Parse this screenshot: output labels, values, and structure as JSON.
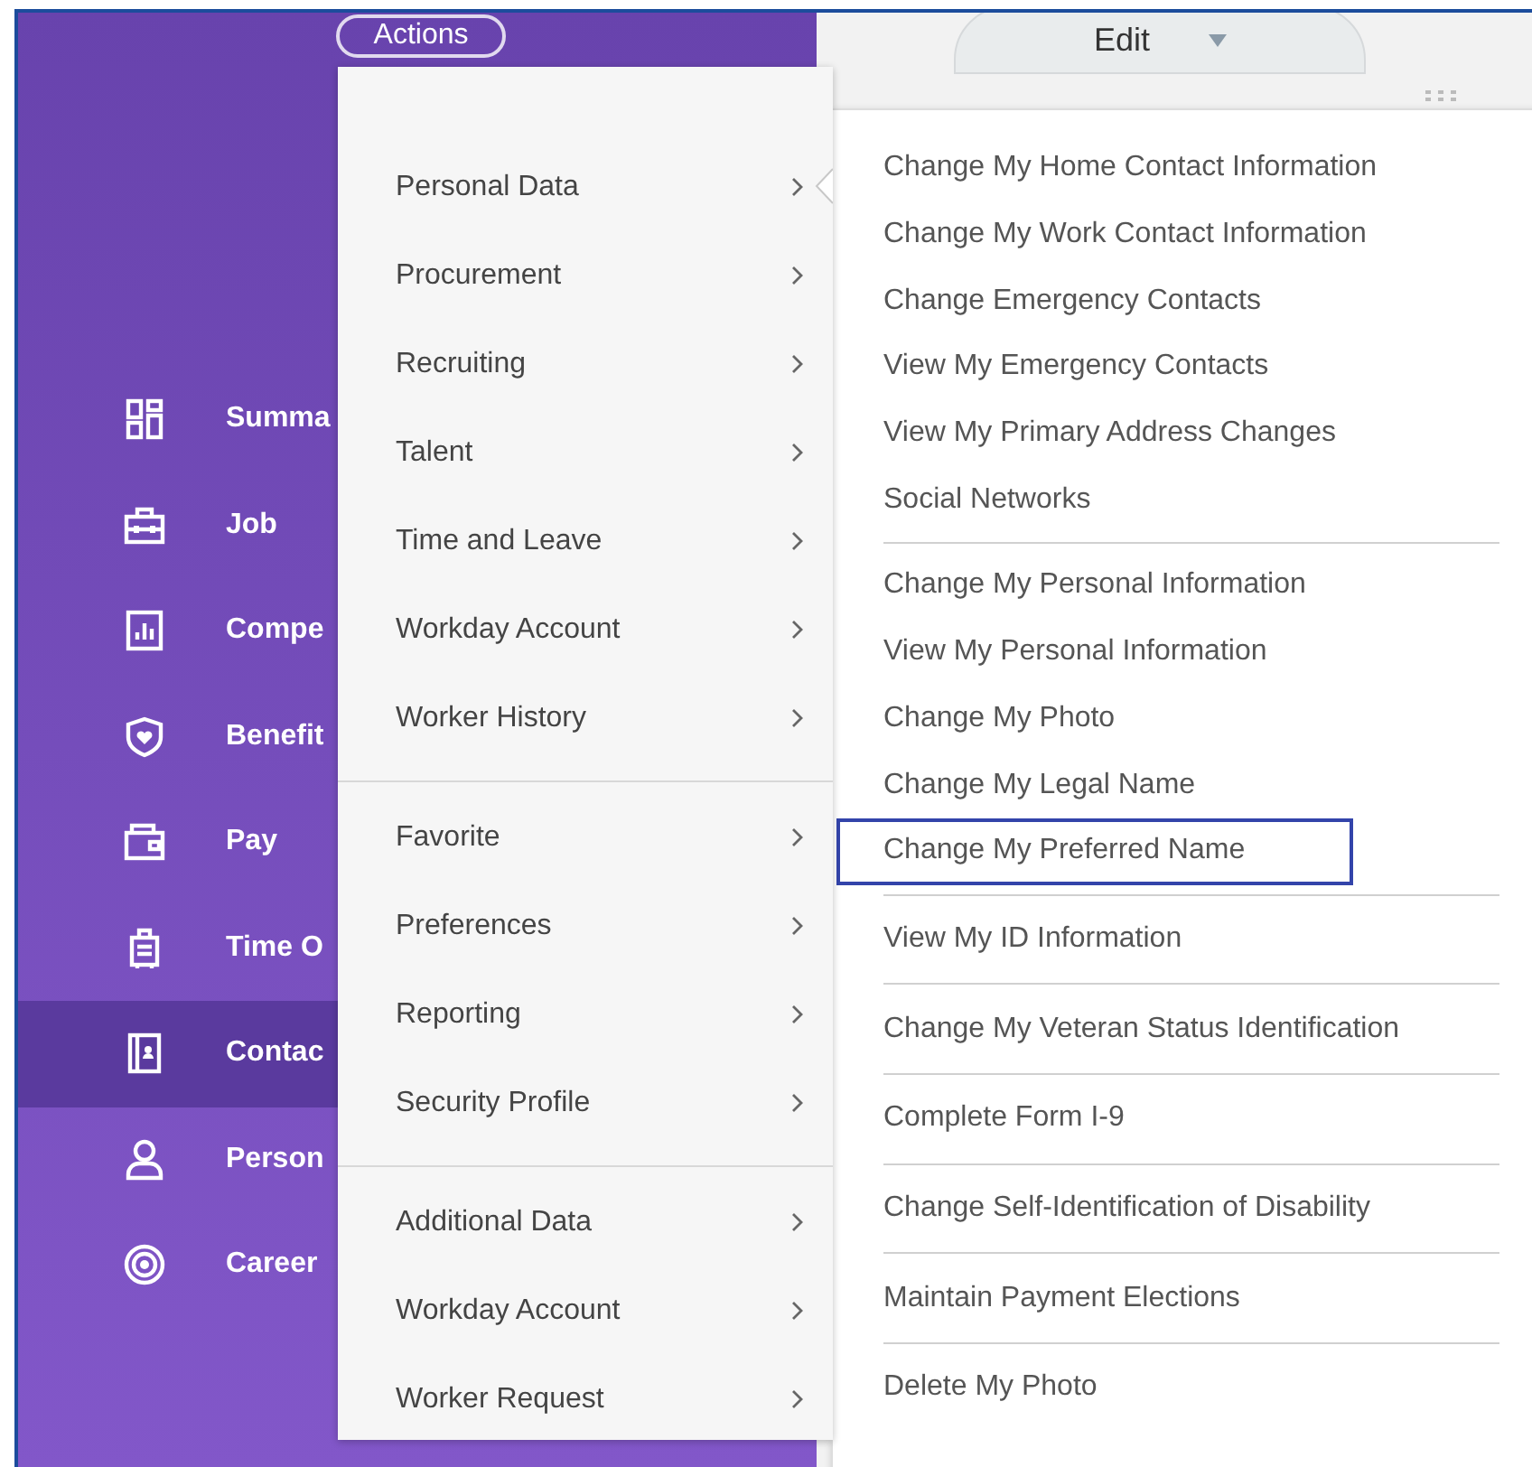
{
  "actions_button": {
    "label": "Actions"
  },
  "edit_button": {
    "label": "Edit"
  },
  "sidebar": {
    "items": [
      {
        "label": "Summa",
        "selected": false
      },
      {
        "label": "Job",
        "selected": false
      },
      {
        "label": "Compe",
        "selected": false
      },
      {
        "label": "Benefit",
        "selected": false
      },
      {
        "label": "Pay",
        "selected": false
      },
      {
        "label": "Time O",
        "selected": false
      },
      {
        "label": "Contac",
        "selected": true
      },
      {
        "label": "Person",
        "selected": false
      },
      {
        "label": "Career",
        "selected": false
      }
    ]
  },
  "actions_menu": {
    "groups": [
      [
        {
          "label": "Personal Data",
          "expanded": true
        },
        {
          "label": "Procurement",
          "expanded": false
        },
        {
          "label": "Recruiting",
          "expanded": false
        },
        {
          "label": "Talent",
          "expanded": false
        },
        {
          "label": "Time and Leave",
          "expanded": false
        },
        {
          "label": "Workday Account",
          "expanded": false
        },
        {
          "label": "Worker History",
          "expanded": false
        }
      ],
      [
        {
          "label": "Favorite",
          "expanded": false
        },
        {
          "label": "Preferences",
          "expanded": false
        },
        {
          "label": "Reporting",
          "expanded": false
        },
        {
          "label": "Security Profile",
          "expanded": false
        }
      ],
      [
        {
          "label": "Additional Data",
          "expanded": false
        },
        {
          "label": "Workday Account",
          "expanded": false
        },
        {
          "label": "Worker Request",
          "expanded": false
        }
      ]
    ]
  },
  "submenu": {
    "groups": [
      [
        {
          "label": "Change My Home Contact Information",
          "selected": false
        },
        {
          "label": "Change My Work Contact Information",
          "selected": false
        },
        {
          "label": "Change Emergency Contacts",
          "selected": false
        },
        {
          "label": "View My Emergency Contacts",
          "selected": false
        },
        {
          "label": "View My Primary Address Changes",
          "selected": false
        },
        {
          "label": "Social Networks",
          "selected": false
        }
      ],
      [
        {
          "label": "Change My Personal Information",
          "selected": false
        },
        {
          "label": "View My Personal Information",
          "selected": false
        },
        {
          "label": "Change My Photo",
          "selected": false
        },
        {
          "label": "Change My Legal Name",
          "selected": false
        },
        {
          "label": "Change My Preferred Name",
          "selected": true
        }
      ],
      [
        {
          "label": "View My ID Information",
          "selected": false
        }
      ],
      [
        {
          "label": "Change My Veteran Status Identification",
          "selected": false
        }
      ],
      [
        {
          "label": "Complete Form I-9",
          "selected": false
        }
      ],
      [
        {
          "label": "Change Self-Identification of Disability",
          "selected": false
        }
      ],
      [
        {
          "label": "Maintain Payment Elections",
          "selected": false
        }
      ],
      [
        {
          "label": "Delete My Photo",
          "selected": false
        }
      ]
    ]
  }
}
